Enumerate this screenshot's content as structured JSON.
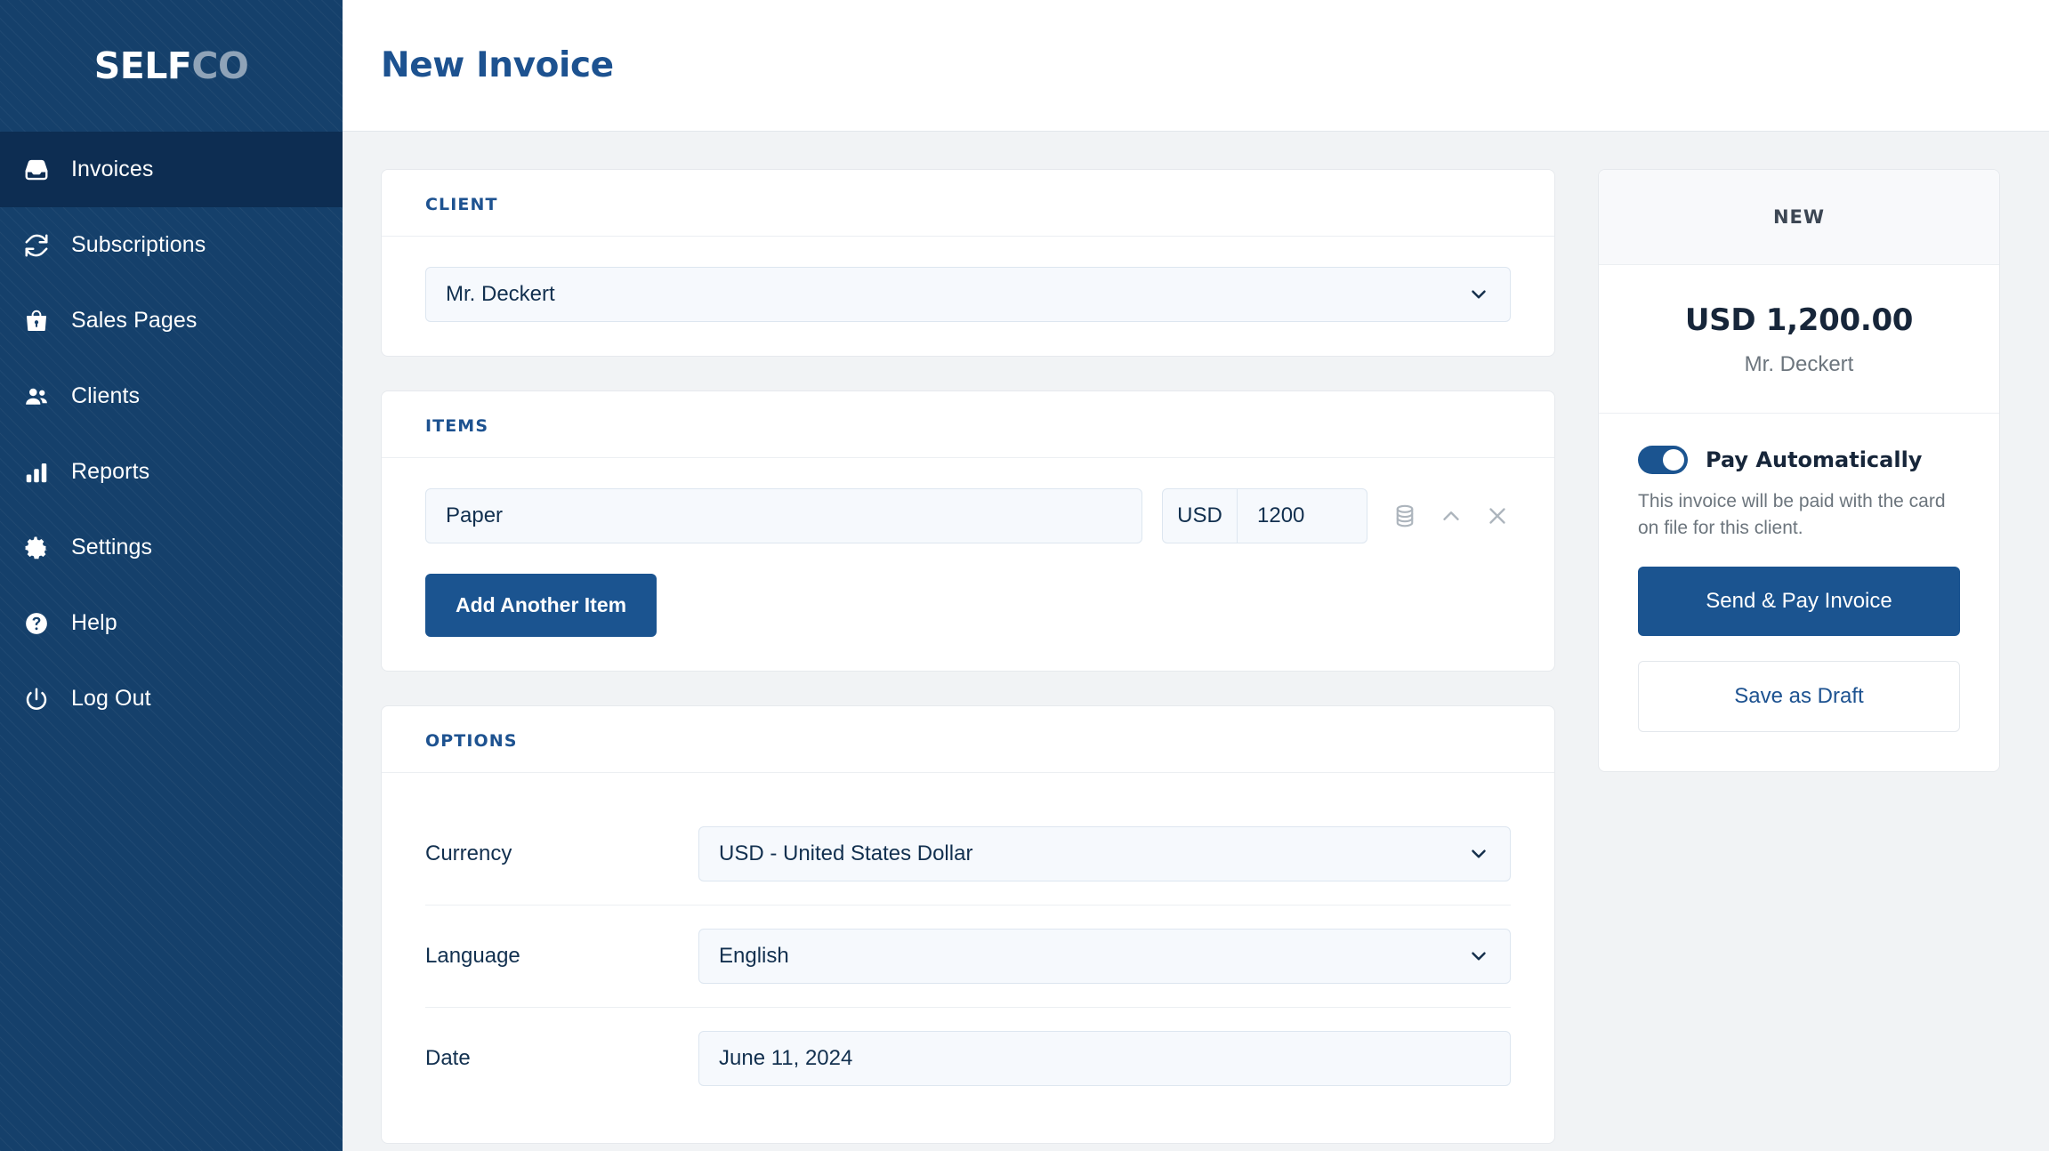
{
  "brand": {
    "name_primary": "SELF",
    "name_secondary": "CO"
  },
  "sidebar": {
    "items": [
      {
        "label": "Invoices",
        "icon": "inbox-icon",
        "active": true
      },
      {
        "label": "Subscriptions",
        "icon": "refresh-icon",
        "active": false
      },
      {
        "label": "Sales Pages",
        "icon": "shopping-bag-icon",
        "active": false
      },
      {
        "label": "Clients",
        "icon": "people-icon",
        "active": false
      },
      {
        "label": "Reports",
        "icon": "bar-chart-icon",
        "active": false
      },
      {
        "label": "Settings",
        "icon": "gear-icon",
        "active": false
      },
      {
        "label": "Help",
        "icon": "question-circle-icon",
        "active": false
      },
      {
        "label": "Log Out",
        "icon": "power-icon",
        "active": false
      }
    ]
  },
  "header": {
    "title": "New Invoice"
  },
  "client_card": {
    "section_title": "CLIENT",
    "selected_client": "Mr. Deckert"
  },
  "items_card": {
    "section_title": "ITEMS",
    "rows": [
      {
        "description": "Paper",
        "currency": "USD",
        "amount": "1200"
      }
    ],
    "row_icons": [
      "database-icon",
      "chevron-up-icon",
      "close-icon"
    ],
    "add_item_label": "Add Another Item"
  },
  "options_card": {
    "section_title": "OPTIONS",
    "rows": [
      {
        "label": "Currency",
        "value": "USD - United States Dollar",
        "has_chevron": true
      },
      {
        "label": "Language",
        "value": "English",
        "has_chevron": true
      },
      {
        "label": "Date",
        "value": "June 11, 2024",
        "has_chevron": false
      }
    ]
  },
  "summary": {
    "status": "NEW",
    "amount": "USD 1,200.00",
    "client": "Mr. Deckert",
    "toggle_label": "Pay Automatically",
    "toggle_on": true,
    "toggle_description": "This invoice will be paid with the card on file for this client.",
    "primary_action": "Send & Pay Invoice",
    "secondary_action": "Save as Draft"
  },
  "colors": {
    "sidebar_bg": "#15406b",
    "sidebar_active": "#0d2d52",
    "accent": "#1b5490",
    "title_blue": "#1d5290",
    "page_bg": "#f1f3f5",
    "input_bg": "#f6f9fd",
    "muted_text": "#6c757d"
  }
}
